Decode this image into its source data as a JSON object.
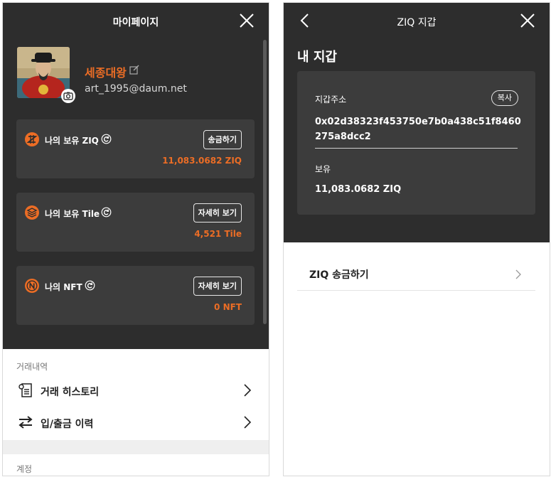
{
  "mypage": {
    "title": "마이페이지",
    "profile": {
      "name": "세종대왕",
      "email": "art_1995@daum.net"
    },
    "cards": [
      {
        "label": "나의 보유 ZIQ",
        "button": "송금하기",
        "value": "11,083.0682 ZIQ",
        "icon": "ziq-coin-icon"
      },
      {
        "label": "나의 보유 Tile",
        "button": "자세히 보기",
        "value": "4,521 Tile",
        "icon": "tile-stack-icon"
      },
      {
        "label": "나의 NFT",
        "button": "자세히 보기",
        "value": "0 NFT",
        "icon": "nft-coin-icon"
      }
    ],
    "sections": {
      "transactions": "거래내역",
      "account": "계정"
    },
    "menu": [
      {
        "label": "거래 히스토리",
        "icon": "receipt-icon"
      },
      {
        "label": "입/출금 이력",
        "icon": "transfer-arrows-icon"
      }
    ]
  },
  "wallet": {
    "title": "ZIQ 지갑",
    "heading": "내 지갑",
    "address_label": "지갑주소",
    "copy_label": "복사",
    "address": "0x02d38323f453750e7b0a438c51f8460275a8dcc2",
    "balance_label": "보유",
    "balance": "11,083.0682 ZIQ",
    "send_row": "ZIQ 송금하기"
  },
  "colors": {
    "accent": "#ec6d25",
    "dark_bg": "#2d2d2d",
    "card_bg": "#3c3c3c"
  }
}
